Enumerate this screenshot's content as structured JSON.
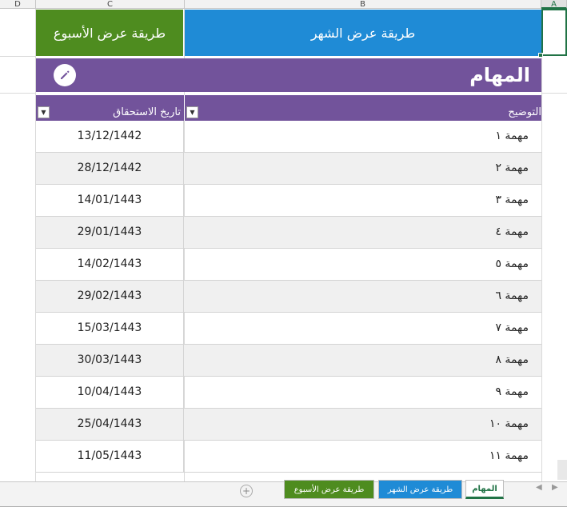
{
  "columns": [
    "D",
    "C",
    "B",
    "A"
  ],
  "nav": {
    "week_label": "طريقة عرض الأسبوع",
    "month_label": "طريقة عرض الشهر"
  },
  "page_title": "المهام",
  "table": {
    "headers": {
      "due_date": "تاريخ الاستحقاق",
      "description": "التوضيح"
    },
    "rows": [
      {
        "date": "13/12/1442",
        "desc": "مهمة ١"
      },
      {
        "date": "28/12/1442",
        "desc": "مهمة ٢"
      },
      {
        "date": "14/01/1443",
        "desc": "مهمة ٣"
      },
      {
        "date": "29/01/1443",
        "desc": "مهمة ٤"
      },
      {
        "date": "14/02/1443",
        "desc": "مهمة ٥"
      },
      {
        "date": "29/02/1443",
        "desc": "مهمة ٦"
      },
      {
        "date": "15/03/1443",
        "desc": "مهمة ٧"
      },
      {
        "date": "30/03/1443",
        "desc": "مهمة ٨"
      },
      {
        "date": "10/04/1443",
        "desc": "مهمة ٩"
      },
      {
        "date": "25/04/1443",
        "desc": "مهمة ١٠"
      },
      {
        "date": "11/05/1443",
        "desc": "مهمة ١١"
      }
    ]
  },
  "sheet_tabs": {
    "week": "طريقة عرض الأسبوع",
    "month": "طريقة عرض الشهر",
    "tasks": "المهام"
  },
  "icons": {
    "edit": "pencil-icon",
    "filter": "dropdown-arrow-icon",
    "add": "plus-circle-icon"
  },
  "colors": {
    "purple": "#72539b",
    "green": "#4e8c1f",
    "blue": "#1f8bd6",
    "excel_green": "#217346"
  }
}
